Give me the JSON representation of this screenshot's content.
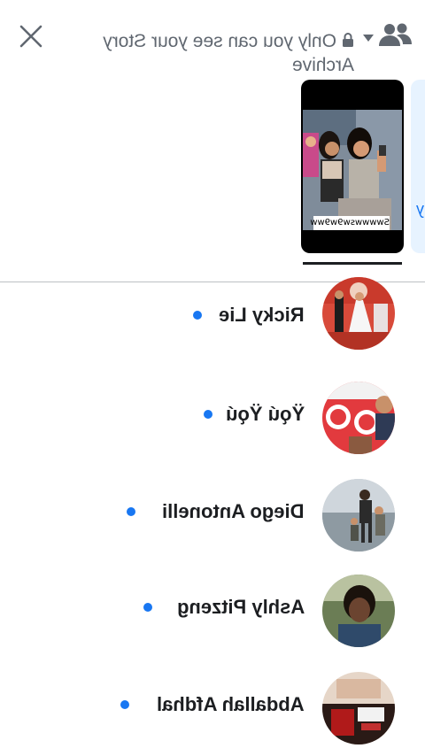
{
  "header": {
    "privacy_line1": "Only you can see your Story",
    "privacy_line2": "Archive",
    "close_icon": "close-icon",
    "lock_icon": "lock-icon",
    "caret_icon": "caret-down-icon",
    "audience_icon": "friends-icon"
  },
  "story": {
    "caption": "Swwwwsw9w9ww",
    "add_glyph": "y"
  },
  "viewers": [
    {
      "name": "Ricky Lie",
      "avatar": "wedding-photo"
    },
    {
      "name": "Ÿǫú Ÿǫú",
      "avatar": "red-banner-photo"
    },
    {
      "name": "Diego Antonelli",
      "avatar": "beach-family-photo"
    },
    {
      "name": "Ashly Pitzeng",
      "avatar": "portrait-photo"
    },
    {
      "name": "Abdallah Afdhal",
      "avatar": "poster-photo"
    }
  ],
  "colors": {
    "accent": "#1877f2",
    "text": "#1c1e21",
    "muted": "#606770",
    "divider": "#bcc0c4"
  }
}
